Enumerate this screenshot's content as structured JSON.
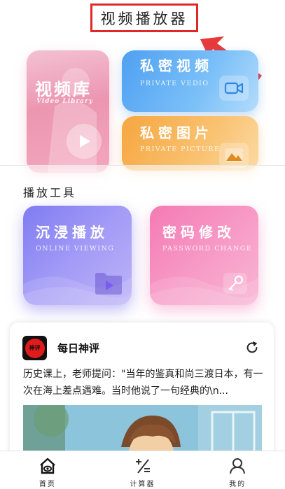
{
  "header": {
    "title": "视频播放器"
  },
  "cards": {
    "library": {
      "title": "视频库",
      "subtitle": "Video Library"
    },
    "private_video": {
      "title": "私密视频",
      "subtitle": "PRIVATE VEDIO"
    },
    "private_picture": {
      "title": "私密图片",
      "subtitle": "PRIVATE PICTURE"
    }
  },
  "tools": {
    "section_title": "播放工具",
    "online": {
      "title": "沉浸播放",
      "subtitle": "ONLINE VIEWING"
    },
    "password": {
      "title": "密码修改",
      "subtitle": "PASSWORD CHANGE"
    }
  },
  "news": {
    "logo_text": "神评",
    "name": "每日神评",
    "text": "历史课上，老师提问：\"当年的鉴真和尚三渡日本，有一次在海上差点遇难。当时他说了一句经典的\\n..."
  },
  "bottom_nav": {
    "items": [
      {
        "label": "首页",
        "icon": "home-icon"
      },
      {
        "label": "计算器",
        "icon": "calculator-icon"
      },
      {
        "label": "我的",
        "icon": "profile-icon"
      }
    ]
  },
  "colors": {
    "title_border": "#e02828",
    "library": "#ec96b2",
    "private_video": "#4fa0f2",
    "private_picture": "#f6a640",
    "online": "#7f7cf3",
    "password": "#f47ab4"
  }
}
